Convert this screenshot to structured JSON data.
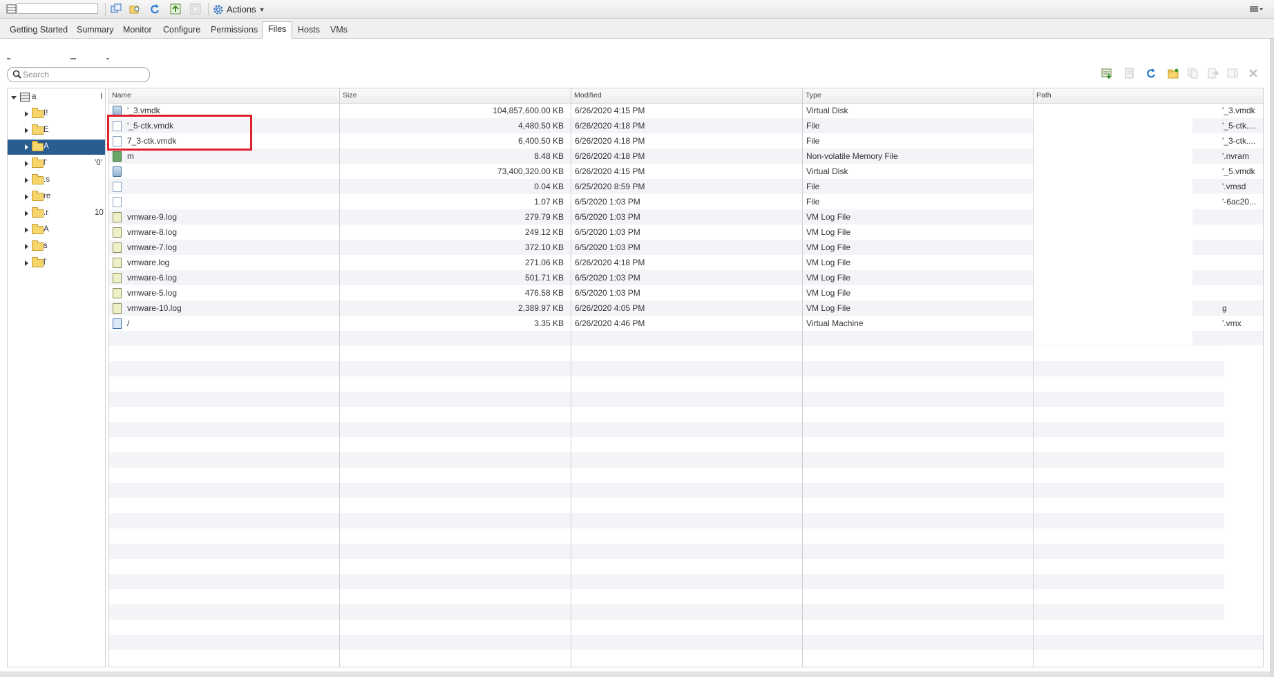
{
  "toolbar": {
    "actions_label": "Actions",
    "icons": [
      "list-icon",
      "new-folder-icon",
      "browse-icon",
      "refresh-icon",
      "upload-icon",
      "disabled-icon",
      "gear-icon",
      "menu-icon"
    ]
  },
  "tabs": [
    {
      "label": "Getting Started",
      "active": false
    },
    {
      "label": "Summary",
      "active": false
    },
    {
      "label": "Monitor",
      "active": false
    },
    {
      "label": "Configure",
      "active": false
    },
    {
      "label": "Permissions",
      "active": false
    },
    {
      "label": "Files",
      "active": true
    },
    {
      "label": "Hosts",
      "active": false
    },
    {
      "label": "VMs",
      "active": false
    }
  ],
  "search": {
    "placeholder": "Search"
  },
  "tree": {
    "root": {
      "label": "a",
      "suffix": "I"
    },
    "items": [
      {
        "label": "I!",
        "suffix": ""
      },
      {
        "label": "E",
        "suffix": ""
      },
      {
        "label": "A",
        "suffix": "",
        "selected": true
      },
      {
        "label": "l'",
        "suffix": "'0'"
      },
      {
        "label": ".s",
        "suffix": ""
      },
      {
        "label": "re",
        "suffix": ""
      },
      {
        "label": ".r",
        "suffix": "10"
      },
      {
        "label": "A",
        "suffix": ""
      },
      {
        "label": "s",
        "suffix": ""
      },
      {
        "label": "l'",
        "suffix": ""
      }
    ]
  },
  "columns": {
    "name": "Name",
    "size": "Size",
    "modified": "Modified",
    "type": "Type",
    "path": "Path"
  },
  "files": [
    {
      "name": "'_3.vmdk",
      "size": "104,857,600.00 KB",
      "modified": "6/26/2020 4:15 PM",
      "type": "Virtual Disk",
      "path": "'_3.vmdk",
      "icon": "disk"
    },
    {
      "name": "'_5-ctk.vmdk",
      "size": "4,480.50 KB",
      "modified": "6/26/2020 4:18 PM",
      "type": "File",
      "path": "'_5-ctk....",
      "icon": "file"
    },
    {
      "name": "7_3-ctk.vmdk",
      "size": "6,400.50 KB",
      "modified": "6/26/2020 4:18 PM",
      "type": "File",
      "path": "'_3-ctk....",
      "icon": "file"
    },
    {
      "name": "m",
      "size": "8.48 KB",
      "modified": "6/26/2020 4:18 PM",
      "type": "Non-volatile Memory File",
      "path": "'.nvram",
      "icon": "nvram"
    },
    {
      "name": "",
      "size": "73,400,320.00 KB",
      "modified": "6/26/2020 4:15 PM",
      "type": "Virtual Disk",
      "path": "'_5.vmdk",
      "icon": "disk"
    },
    {
      "name": "",
      "size": "0.04 KB",
      "modified": "6/25/2020 8:59 PM",
      "type": "File",
      "path": "'.vmsd",
      "icon": "file"
    },
    {
      "name": "",
      "size": "1.07 KB",
      "modified": "6/5/2020 1:03 PM",
      "type": "File",
      "path": "'-6ac20...",
      "icon": "file"
    },
    {
      "name": "vmware-9.log",
      "size": "279.79 KB",
      "modified": "6/5/2020 1:03 PM",
      "type": "VM Log File",
      "path": "",
      "icon": "log"
    },
    {
      "name": "vmware-8.log",
      "size": "249.12 KB",
      "modified": "6/5/2020 1:03 PM",
      "type": "VM Log File",
      "path": "",
      "icon": "log"
    },
    {
      "name": "vmware-7.log",
      "size": "372.10 KB",
      "modified": "6/5/2020 1:03 PM",
      "type": "VM Log File",
      "path": "",
      "icon": "log"
    },
    {
      "name": "vmware.log",
      "size": "271.06 KB",
      "modified": "6/26/2020 4:18 PM",
      "type": "VM Log File",
      "path": "",
      "icon": "log"
    },
    {
      "name": "vmware-6.log",
      "size": "501.71 KB",
      "modified": "6/5/2020 1:03 PM",
      "type": "VM Log File",
      "path": "",
      "icon": "log"
    },
    {
      "name": "vmware-5.log",
      "size": "476.58 KB",
      "modified": "6/5/2020 1:03 PM",
      "type": "VM Log File",
      "path": "",
      "icon": "log"
    },
    {
      "name": "vmware-10.log",
      "size": "2,389.97 KB",
      "modified": "6/26/2020 4:05 PM",
      "type": "VM Log File",
      "path": "g",
      "icon": "log"
    },
    {
      "name": "/",
      "size": "3.35 KB",
      "modified": "6/26/2020 4:46 PM",
      "type": "Virtual Machine",
      "path": "'.vmx",
      "icon": "vm"
    }
  ],
  "right_tools": [
    "download-icon",
    "upload-file-icon",
    "refresh-icon",
    "new-folder-icon",
    "copy-icon",
    "move-icon",
    "rename-icon",
    "delete-icon"
  ],
  "colors": {
    "selection": "#2a5d8f",
    "highlight": "#e0202a",
    "stripe": "#f2f4f7"
  }
}
